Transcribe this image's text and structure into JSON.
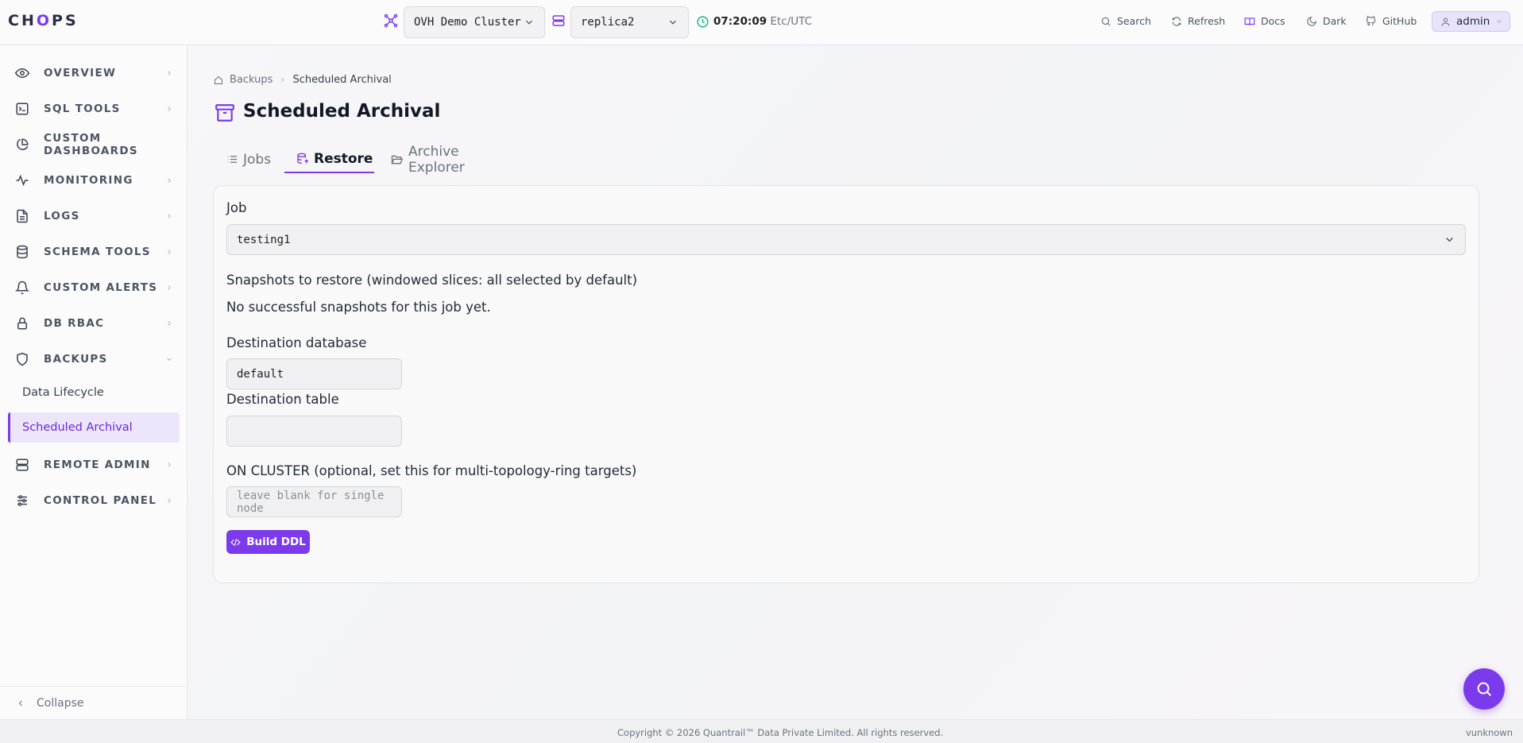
{
  "app": {
    "logo": "CHOPS",
    "accent_color": "#7c3aed"
  },
  "header": {
    "cluster": {
      "value": "OVH Demo Cluster",
      "icon": "cluster-icon"
    },
    "replica": {
      "value": "replica2",
      "icon": "server-icon"
    },
    "time": {
      "value": "07:20:09",
      "zone": "Etc/UTC",
      "icon": "clock-icon"
    },
    "tools": [
      {
        "label": "Search",
        "icon": "search-icon"
      },
      {
        "label": "Refresh",
        "icon": "refresh-icon"
      },
      {
        "label": "Docs",
        "icon": "book-icon"
      },
      {
        "label": "Dark",
        "icon": "moon-icon"
      },
      {
        "label": "GitHub",
        "icon": "github-icon"
      }
    ],
    "user": {
      "label": "admin",
      "icon": "user-icon"
    }
  },
  "sidebar": {
    "items": [
      {
        "label": "OVERVIEW",
        "icon": "eye-icon"
      },
      {
        "label": "SQL TOOLS",
        "icon": "terminal-icon"
      },
      {
        "label": "CUSTOM DASHBOARDS",
        "icon": "pie-chart-icon"
      },
      {
        "label": "MONITORING",
        "icon": "activity-icon"
      },
      {
        "label": "LOGS",
        "icon": "file-text-icon"
      },
      {
        "label": "SCHEMA TOOLS",
        "icon": "database-icon"
      },
      {
        "label": "CUSTOM ALERTS",
        "icon": "bell-icon"
      },
      {
        "label": "DB RBAC",
        "icon": "lock-icon"
      },
      {
        "label": "BACKUPS",
        "icon": "shield-icon"
      },
      {
        "label": "REMOTE ADMIN",
        "icon": "server-icon"
      },
      {
        "label": "CONTROL PANEL",
        "icon": "sliders-icon"
      }
    ],
    "backups_sub": [
      {
        "label": "Data Lifecycle"
      },
      {
        "label": "Scheduled Archival",
        "active": true
      }
    ],
    "collapse_label": "Collapse"
  },
  "breadcrumb": {
    "root": "Backups",
    "current": "Scheduled Archival"
  },
  "page": {
    "title": "Scheduled Archival",
    "icon": "archive-icon"
  },
  "tabs": [
    {
      "label": "Jobs",
      "icon": "list-icon"
    },
    {
      "label": "Restore",
      "icon": "database-restore-icon",
      "active": true
    },
    {
      "label": "Archive Explorer",
      "icon": "folder-open-icon"
    }
  ],
  "form": {
    "job_label": "Job",
    "job_value": "testing1",
    "snapshots_label": "Snapshots to restore (windowed slices: all selected by default)",
    "snapshots_empty": "No successful snapshots for this job yet.",
    "dest_db_label": "Destination database",
    "dest_db_value": "default",
    "dest_table_label": "Destination table",
    "dest_table_value": "",
    "on_cluster_label": "ON CLUSTER (optional, set this for multi-topology-ring targets)",
    "on_cluster_placeholder": "leave blank for single node",
    "build_button": "Build DDL"
  },
  "footer": {
    "copyright": "Copyright © 2026 Quantrail™ Data Private Limited. All rights reserved.",
    "version": "vunknown"
  }
}
